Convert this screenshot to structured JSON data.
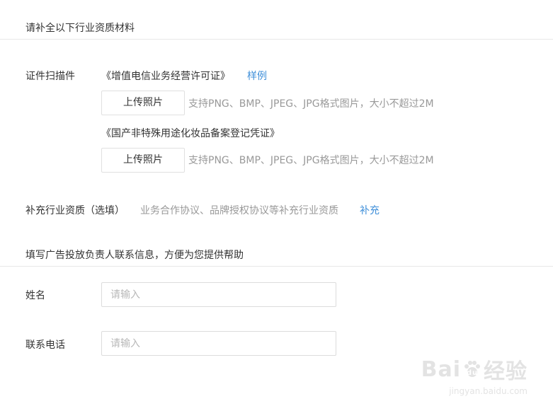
{
  "section1": {
    "title": "请补全以下行业资质材料"
  },
  "certificates": {
    "label": "证件扫描件",
    "items": [
      {
        "name": "《增值电信业务经营许可证》",
        "sample_link": "样例",
        "upload_label": "上传照片",
        "hint": "支持PNG、BMP、JPEG、JPG格式图片，大小不超过2M"
      },
      {
        "name": "《国产非特殊用途化妆品备案登记凭证》",
        "upload_label": "上传照片",
        "hint": "支持PNG、BMP、JPEG、JPG格式图片，大小不超过2M"
      }
    ]
  },
  "supplement": {
    "label": "补充行业资质（选填）",
    "hint": "业务合作协议、品牌授权协议等补充行业资质",
    "link": "补充"
  },
  "section2": {
    "title": "填写广告投放负责人联系信息，方便为您提供帮助"
  },
  "contact": {
    "name_label": "姓名",
    "name_placeholder": "请输入",
    "phone_label": "联系电话",
    "phone_placeholder": "请输入"
  },
  "watermark": {
    "logo": "Bai du 经验",
    "url": "jingyan.baidu.com"
  }
}
